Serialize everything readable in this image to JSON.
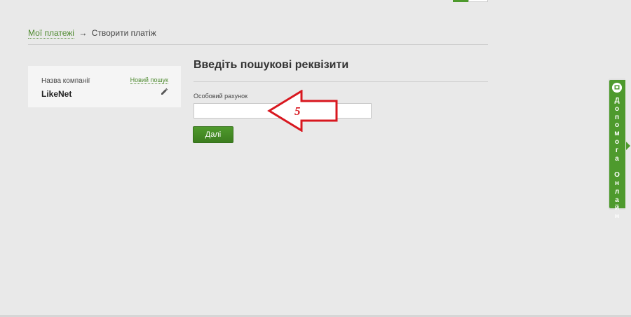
{
  "breadcrumb": {
    "link": "Мої платежі",
    "arrow": "→",
    "current": "Створити платіж"
  },
  "company_card": {
    "label": "Назва компанії",
    "name": "LikeNet",
    "new_search": "Новий пошук",
    "edit_icon": "pencil-icon"
  },
  "form": {
    "title": "Введіть пошукові реквізити",
    "field_label": "Особовий рахунок",
    "field_value": "",
    "next_label": "Далі"
  },
  "annotation": {
    "number": "5",
    "color": "#d8171f"
  },
  "help": {
    "text": "Допомога Онлайн",
    "icon": "chat-icon",
    "color": "#4e9a2d"
  },
  "colors": {
    "accent": "#4e9a2d",
    "link": "#4e8a2f",
    "background": "#e9e9e9"
  }
}
